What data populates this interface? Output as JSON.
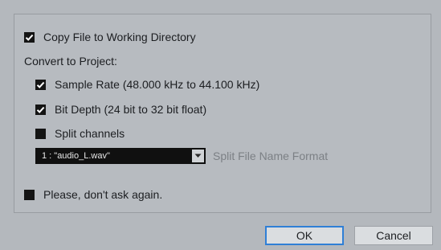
{
  "options": {
    "copy_file": {
      "label": "Copy File to Working Directory",
      "checked": true
    },
    "convert_heading": "Convert to Project:",
    "sample_rate": {
      "label": "Sample Rate (48.000 kHz to 44.100 kHz)",
      "checked": true
    },
    "bit_depth": {
      "label": "Bit Depth (24 bit to 32 bit float)",
      "checked": true
    },
    "split_channels": {
      "label": "Split channels",
      "checked": false
    },
    "file_format_select": {
      "value": "1 : \"audio_L.wav\""
    },
    "file_format_label": "Split File Name Format",
    "dont_ask": {
      "label": "Please, don't ask again.",
      "checked": false
    }
  },
  "buttons": {
    "ok": "OK",
    "cancel": "Cancel"
  },
  "colors": {
    "background": "#b4b8bd",
    "checkbox": "#141414",
    "focus_border": "#2f7fd6",
    "disabled_text": "#7c8085"
  }
}
